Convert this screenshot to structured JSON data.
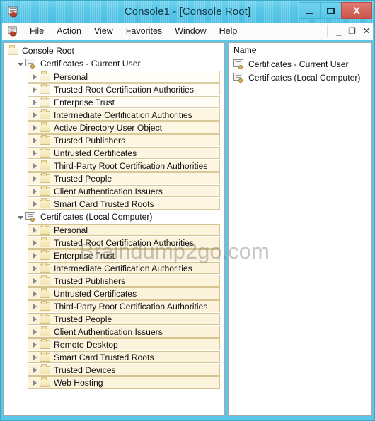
{
  "window": {
    "title": "Console1 - [Console Root]",
    "app_icon": "mmc-console-icon",
    "caption_buttons": [
      {
        "name": "minimize-button",
        "glyph": "minimize"
      },
      {
        "name": "maximize-button",
        "glyph": "maximize"
      },
      {
        "name": "close-button",
        "glyph": "X"
      }
    ]
  },
  "menubar": {
    "items": [
      {
        "label": "File"
      },
      {
        "label": "Action"
      },
      {
        "label": "View"
      },
      {
        "label": "Favorites"
      },
      {
        "label": "Window"
      },
      {
        "label": "Help"
      }
    ],
    "mdi_buttons": [
      {
        "name": "mdi-minimize-button",
        "glyph": "_"
      },
      {
        "name": "mdi-restore-button",
        "glyph": "❐"
      },
      {
        "name": "mdi-close-button",
        "glyph": "✕"
      }
    ]
  },
  "tree": {
    "root": {
      "label": "Console Root",
      "icon": "folder-icon"
    },
    "groups": [
      {
        "label": "Certificates - Current User",
        "icon": "certificate-icon",
        "expanded": true,
        "children": [
          {
            "label": "Personal"
          },
          {
            "label": "Trusted Root Certification Authorities"
          },
          {
            "label": "Enterprise Trust"
          },
          {
            "label": "Intermediate Certification Authorities"
          },
          {
            "label": "Active Directory User Object"
          },
          {
            "label": "Trusted Publishers"
          },
          {
            "label": "Untrusted Certificates"
          },
          {
            "label": "Third-Party Root Certification Authorities"
          },
          {
            "label": "Trusted People"
          },
          {
            "label": "Client Authentication Issuers"
          },
          {
            "label": "Smart Card Trusted Roots"
          }
        ]
      },
      {
        "label": "Certificates (Local Computer)",
        "icon": "certificate-icon",
        "expanded": true,
        "children": [
          {
            "label": "Personal"
          },
          {
            "label": "Trusted Root Certification Authorities"
          },
          {
            "label": "Enterprise Trust"
          },
          {
            "label": "Intermediate Certification Authorities"
          },
          {
            "label": "Trusted Publishers"
          },
          {
            "label": "Untrusted Certificates"
          },
          {
            "label": "Third-Party Root Certification Authorities"
          },
          {
            "label": "Trusted People"
          },
          {
            "label": "Client Authentication Issuers"
          },
          {
            "label": "Remote Desktop"
          },
          {
            "label": "Smart Card Trusted Roots"
          },
          {
            "label": "Trusted Devices"
          },
          {
            "label": "Web Hosting"
          }
        ]
      }
    ]
  },
  "right_pane": {
    "column_header": "Name",
    "rows": [
      {
        "label": "Certificates - Current User",
        "icon": "certificate-icon"
      },
      {
        "label": "Certificates (Local Computer)",
        "icon": "certificate-icon"
      }
    ]
  },
  "watermark": {
    "text": "Braindump2go.com"
  },
  "colors": {
    "titlebar": "#57c6e7",
    "close_button": "#c9544b",
    "pane_background": "#ffffff",
    "row_border": "#d9cda3"
  }
}
